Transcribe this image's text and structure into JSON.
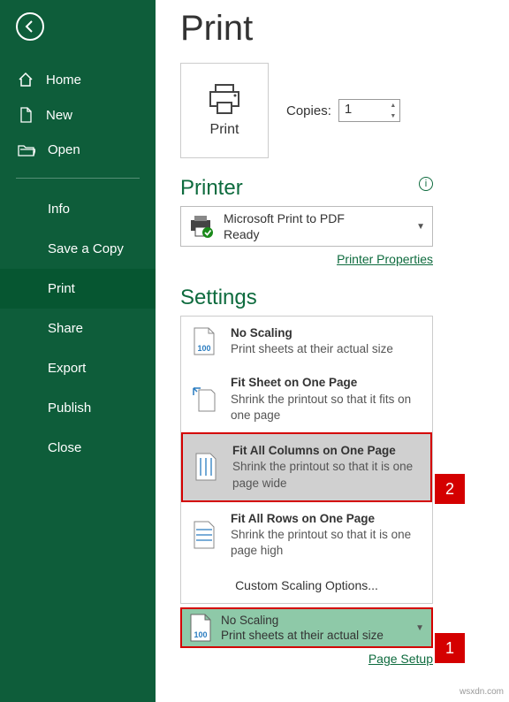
{
  "sidebar": {
    "items": [
      "Home",
      "New",
      "Open"
    ],
    "subitems": [
      "Info",
      "Save a Copy",
      "Print",
      "Share",
      "Export",
      "Publish",
      "Close"
    ],
    "activeSub": "Print"
  },
  "main": {
    "title": "Print",
    "printBtn": "Print",
    "copiesLabel": "Copies:",
    "copiesValue": "1",
    "printerHeading": "Printer",
    "printer": {
      "name": "Microsoft Print to PDF",
      "status": "Ready"
    },
    "printerProps": "Printer Properties",
    "settingsHeading": "Settings",
    "scaleOptions": [
      {
        "title": "No Scaling",
        "desc": "Print sheets at their actual size"
      },
      {
        "title": "Fit Sheet on One Page",
        "desc": "Shrink the printout so that it fits on one page"
      },
      {
        "title": "Fit All Columns on One Page",
        "desc": "Shrink the printout so that it is one page wide"
      },
      {
        "title": "Fit All Rows on One Page",
        "desc": "Shrink the printout so that it is one page high"
      }
    ],
    "customScaling": "Custom Scaling Options...",
    "currentScale": {
      "title": "No Scaling",
      "desc": "Print sheets at their actual size"
    },
    "pageSetup": "Page Setup"
  },
  "callouts": {
    "one": "1",
    "two": "2"
  },
  "watermark": "wsxdn.com"
}
